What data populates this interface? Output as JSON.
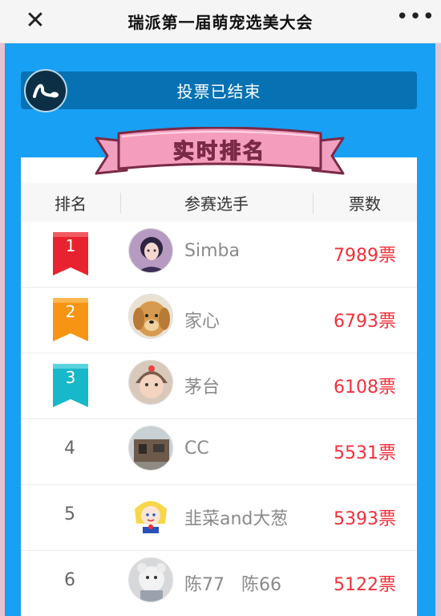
{
  "window": {
    "title": "瑞派第一届萌宠选美大会",
    "close_glyph": "✕",
    "more_glyph": "•••"
  },
  "banner": {
    "status": "投票已结束",
    "speaker_icon": "speaker-icon"
  },
  "ranking": {
    "title": "实时排名",
    "columns": [
      "排名",
      "参赛选手",
      "票数"
    ],
    "rows": [
      {
        "rank": "1",
        "name": "Simba",
        "votes": "7989票",
        "badge_color": "#e8232f"
      },
      {
        "rank": "2",
        "name": "家心",
        "votes": "6793票",
        "badge_color": "#f79413"
      },
      {
        "rank": "3",
        "name": "茅台",
        "votes": "6108票",
        "badge_color": "#16b8c9"
      },
      {
        "rank": "4",
        "name": "CC",
        "votes": "5531票"
      },
      {
        "rank": "5",
        "name": "韭菜and大葱",
        "votes": "5393票"
      },
      {
        "rank": "6",
        "name": "陈77   陈66",
        "votes": "5122票"
      }
    ]
  },
  "colors": {
    "blue_bg": "#18a0f5",
    "vote_bar": "#0672b4",
    "votes_red": "#f0303a",
    "ribbon_pink": "#f59dbc"
  }
}
